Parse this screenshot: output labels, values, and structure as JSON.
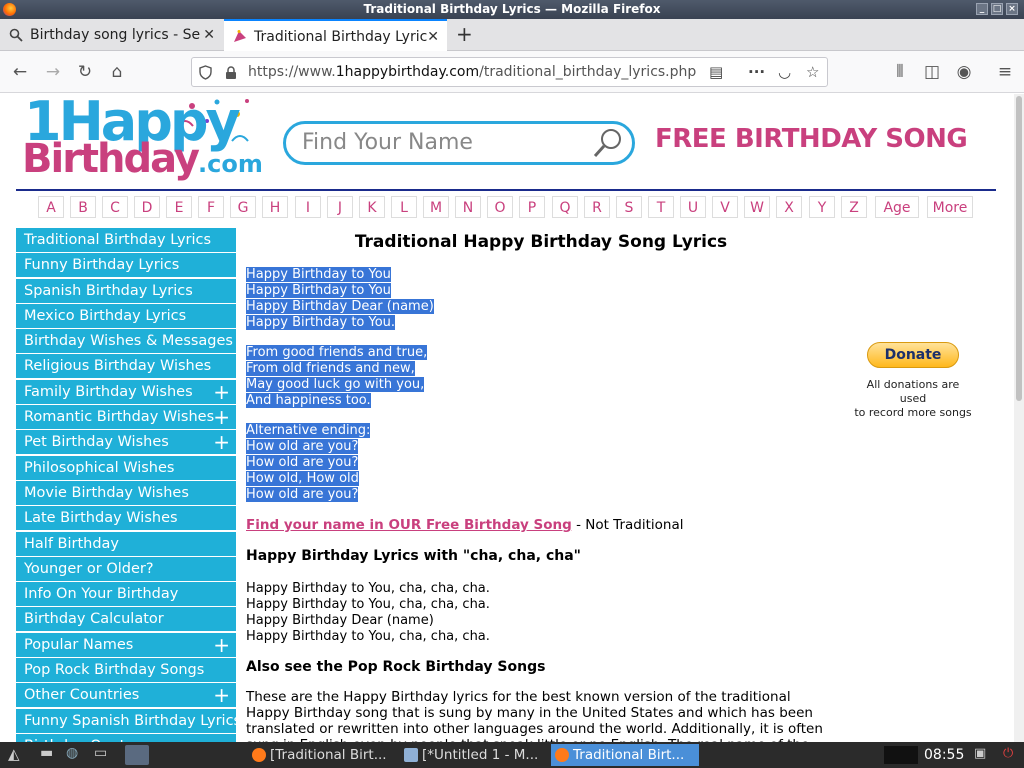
{
  "window": {
    "title": "Traditional Birthday Lyrics — Mozilla Firefox"
  },
  "tabs": [
    {
      "label": "Birthday song lyrics - Se"
    },
    {
      "label": "Traditional Birthday Lyric"
    }
  ],
  "url": {
    "prefix": "https://www.",
    "domain": "1happybirthday.com",
    "path": "/traditional_birthday_lyrics.php"
  },
  "header": {
    "logo_line1": "1Happy",
    "logo_line2": "Birthday",
    "logo_suffix": ".com",
    "search_placeholder": "Find Your Name",
    "tagline": "FREE BIRTHDAY SONG"
  },
  "alphabet": [
    "A",
    "B",
    "C",
    "D",
    "E",
    "F",
    "G",
    "H",
    "I",
    "J",
    "K",
    "L",
    "M",
    "N",
    "O",
    "P",
    "Q",
    "R",
    "S",
    "T",
    "U",
    "V",
    "W",
    "X",
    "Y",
    "Z",
    "Age",
    "More"
  ],
  "sidebar": [
    {
      "label": "Traditional Birthday Lyrics",
      "plus": ""
    },
    {
      "label": "Funny Birthday Lyrics",
      "plus": ""
    },
    {
      "label": "Spanish Birthday Lyrics",
      "plus": ""
    },
    {
      "label": "Mexico Birthday Lyrics",
      "plus": ""
    },
    {
      "label": "Birthday Wishes & Messages",
      "plus": ""
    },
    {
      "label": "Religious Birthday Wishes",
      "plus": ""
    },
    {
      "label": "Family Birthday Wishes",
      "plus": "+"
    },
    {
      "label": "Romantic Birthday Wishes",
      "plus": "+"
    },
    {
      "label": "Pet Birthday Wishes",
      "plus": "+"
    },
    {
      "label": "Philosophical Wishes",
      "plus": ""
    },
    {
      "label": "Movie Birthday Wishes",
      "plus": ""
    },
    {
      "label": "Late Birthday Wishes",
      "plus": ""
    },
    {
      "label": "Half Birthday",
      "plus": ""
    },
    {
      "label": "Younger or Older?",
      "plus": ""
    },
    {
      "label": "Info On Your Birthday",
      "plus": ""
    },
    {
      "label": "Birthday Calculator",
      "plus": ""
    },
    {
      "label": "Popular Names",
      "plus": "+"
    },
    {
      "label": "Pop Rock Birthday Songs",
      "plus": ""
    },
    {
      "label": "Other Countries",
      "plus": "+"
    },
    {
      "label": "Funny Spanish Birthday Lyrics",
      "plus": ""
    },
    {
      "label": "Birthday Quotes",
      "plus": ""
    }
  ],
  "main": {
    "title": "Traditional Happy Birthday Song Lyrics",
    "verse1": [
      "Happy Birthday to You",
      "Happy Birthday to You",
      "Happy Birthday Dear (name)",
      "Happy Birthday to You."
    ],
    "verse2": [
      "From good friends and true,",
      "From old friends and new,",
      "May good luck go with you,",
      "And happiness too."
    ],
    "verse3": [
      "Alternative ending:",
      "How old are you?",
      "How old are you?",
      "How old, How old",
      "How old are you?"
    ],
    "find_link": "Find your name in OUR Free Birthday Song",
    "find_suffix": " - Not Traditional",
    "cha_heading": "Happy Birthday Lyrics with \"cha, cha, cha\"",
    "verse4": [
      "Happy Birthday to You, cha, cha, cha.",
      "Happy Birthday to You, cha, cha, cha.",
      "Happy Birthday Dear (name)",
      "Happy Birthday to You, cha, cha, cha."
    ],
    "pop_heading": "Also see the Pop Rock Birthday Songs",
    "paragraph": "These are the Happy Birthday lyrics for the best known version of the traditional Happy Birthday song that is sung by many in the United States and which has been translated or rewritten into other languages around the world. Additionally, it is often sung in English even by people that speak little or no English. The real name of the song is \"Happy Birthday to You\""
  },
  "donate": {
    "button": "Donate",
    "note_line1": "All donations are used",
    "note_line2": "to record more songs"
  },
  "taskbar": {
    "items": [
      "[Traditional Birt...",
      "[*Untitled 1 - M...",
      "Traditional Birt..."
    ],
    "clock": "08:55"
  },
  "colors": {
    "accent": "#c9407e",
    "sidebar": "#1fb0d8",
    "selection": "#3875d7"
  }
}
